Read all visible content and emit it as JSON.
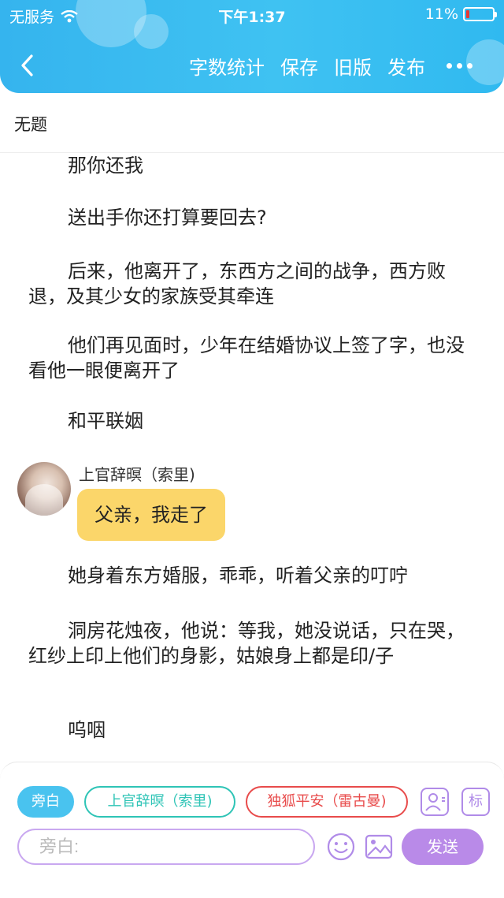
{
  "status_bar": {
    "carrier": "无服务",
    "time": "下午1:37",
    "battery": "11%",
    "battery_level": 0.11
  },
  "nav": {
    "back_icon": "chevron-left-icon",
    "actions": [
      "字数统计",
      "保存",
      "旧版",
      "发布"
    ],
    "more_icon": "more-dots-icon"
  },
  "doc": {
    "title": "无题"
  },
  "content": {
    "paragraphs_before": [
      "那你还我",
      "送出手你还打算要回去?",
      "后来，他离开了，东西方之间的战争，西方败退，及其少女的家族受其牵连",
      "他们再见面时，少年在结婚协议上签了字，也没看他一眼便离开了",
      "和平联姻"
    ],
    "dialogue": {
      "speaker": "上官辞暝（索里)",
      "text": "父亲，我走了"
    },
    "paragraphs_after": [
      "她身着东方婚服，乖乖，听着父亲的叮咛",
      "洞房花烛夜，他说：等我，她没说话，只在哭，红纱上印上他们的身影，姑娘身上都是印/子",
      "呜咽"
    ]
  },
  "composer": {
    "roles": [
      "旁白",
      "上官辞暝（索里)",
      "独狐平安（雷古曼)"
    ],
    "tag_label": "标",
    "input_placeholder": "旁白:",
    "send_label": "发送",
    "colors": {
      "accent": "#49c3ef",
      "role_teal": "#2ec4b6",
      "role_red": "#e84b4b",
      "purple": "#b98ae8",
      "bubble": "#fbd66a"
    }
  }
}
